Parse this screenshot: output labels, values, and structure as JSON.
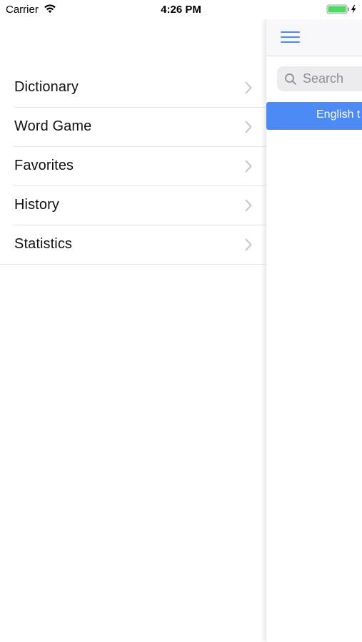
{
  "status_bar": {
    "carrier": "Carrier",
    "time": "4:26 PM",
    "battery_color": "#4cd964"
  },
  "side_menu": {
    "items": [
      {
        "label": "Dictionary",
        "icon": "chevron-right-icon"
      },
      {
        "label": "Word Game",
        "icon": "chevron-right-icon"
      },
      {
        "label": "Favorites",
        "icon": "chevron-right-icon"
      },
      {
        "label": "History",
        "icon": "chevron-right-icon"
      },
      {
        "label": "Statistics",
        "icon": "chevron-right-icon"
      }
    ]
  },
  "main": {
    "nav_icon": "hamburger-icon",
    "search": {
      "placeholder": "Search",
      "value": ""
    },
    "language_bar": {
      "label": "English t"
    }
  },
  "colors": {
    "accent": "#4c8bf5",
    "chevron": "#c4c4c8",
    "separator": "#e4e4e6"
  }
}
